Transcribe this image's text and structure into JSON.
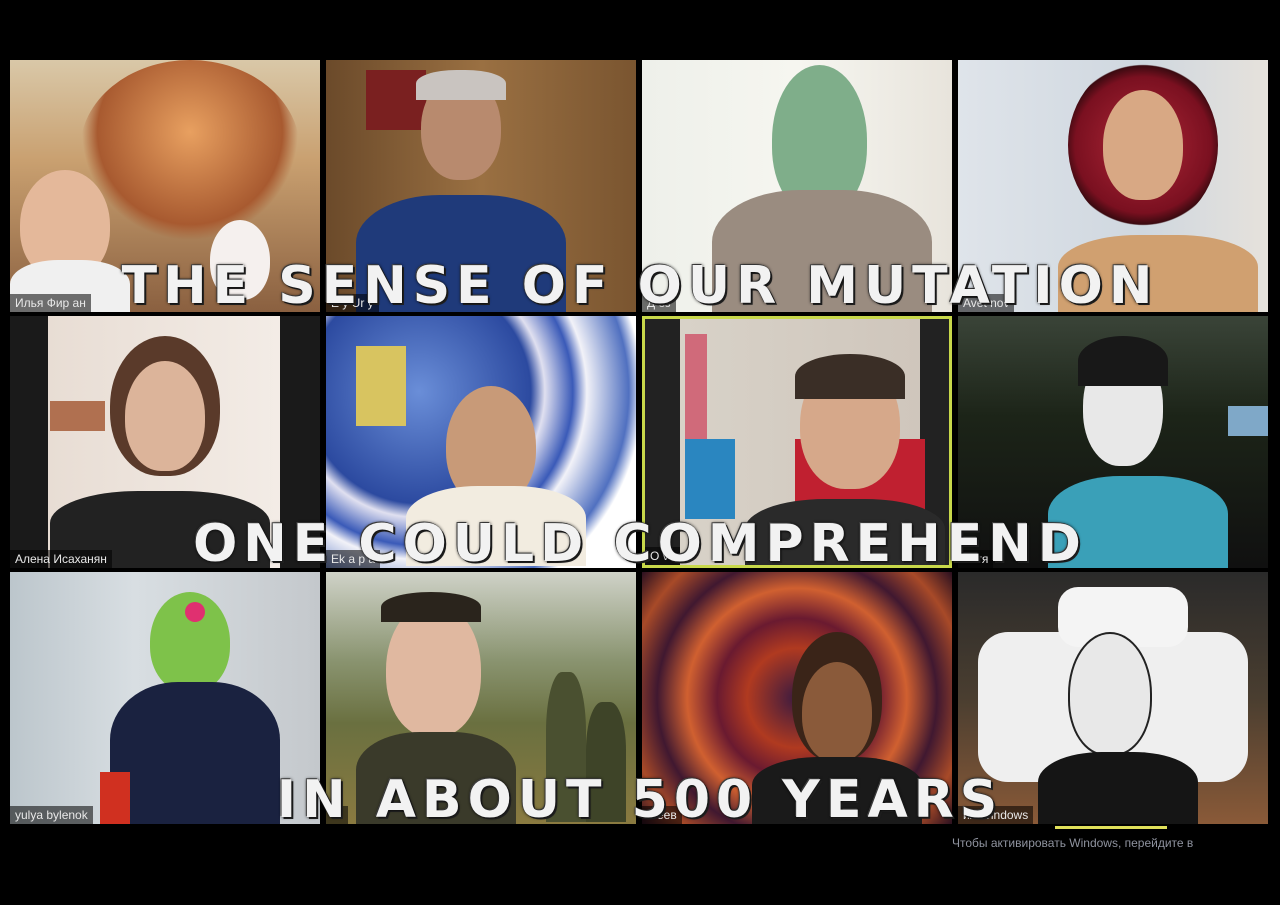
{
  "captions": {
    "line1": "THE SENSE OF OUR MUTATION",
    "line2": "ONE COULD COMPREHEND",
    "line3": "IN ABOUT 500 YEARS"
  },
  "tiles": [
    {
      "name": "Илья Фир     ан"
    },
    {
      "name": "E    y Ur      y"
    },
    {
      "name": "Д   оз"
    },
    {
      "name": "Avet   nov"
    },
    {
      "name": "Алена Исаханян"
    },
    {
      "name": "Ek   а   р   а"
    },
    {
      "name": "О        va"
    },
    {
      "name": "Катя"
    },
    {
      "name": "yulya bylenok"
    },
    {
      "name": "те"
    },
    {
      "name": "а   еев"
    },
    {
      "name": "ия Windows"
    }
  ],
  "watermark": {
    "title": "ия Windows",
    "subtitle": "Чтобы активировать Windows, перейдите в"
  },
  "colors": {
    "background": "#000000",
    "active_border": "#c8d84a",
    "caption": "#f2f2f2"
  }
}
